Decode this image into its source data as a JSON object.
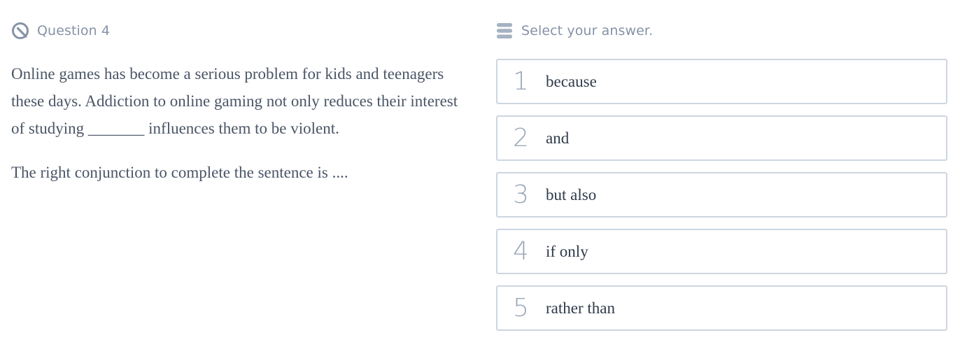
{
  "question": {
    "header_label": "Question 4",
    "icon": "question-mark-circle-icon",
    "body": "Online games has become a serious problem for kids and teenagers these days. Addiction to online gaming not only reduces their interest of studying _______ influences them to be violent.",
    "prompt": "The right conjunction to complete the sentence is ...."
  },
  "answers": {
    "header_label": "Select your answer.",
    "icon": "list-icon",
    "options": [
      {
        "number": "1",
        "label": "because"
      },
      {
        "number": "2",
        "label": "and"
      },
      {
        "number": "3",
        "label": "but also"
      },
      {
        "number": "4",
        "label": "if only"
      },
      {
        "number": "5",
        "label": "rather than"
      }
    ]
  },
  "colors": {
    "muted_text": "#8593a6",
    "body_text": "#4a5566",
    "option_border": "#cdd6e1",
    "option_number": "#9aa7b8"
  }
}
